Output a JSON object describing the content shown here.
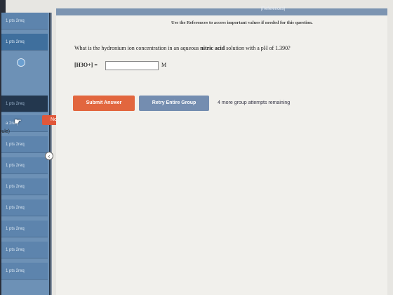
{
  "header": {
    "references_label": "[References]",
    "notice": "Use the References to access important values if needed for this question."
  },
  "question": {
    "text_before": "What is the hydronium ion concentration in an aqueous ",
    "bold_term": "nitric acid",
    "text_after": " solution with a pH of 1.390?",
    "input_label": "[H3O+] =",
    "answer_value": "",
    "unit": "M"
  },
  "actions": {
    "submit_label": "Submit Answer",
    "retry_label": "Retry Entire Group",
    "attempts_text": "4 more group attempts remaining"
  },
  "sidebar": {
    "items": [
      {
        "label": "1 pts   2req"
      },
      {
        "label": "1 pts   2req"
      },
      {
        "label": "1 pts   2req"
      },
      {
        "label": "a   2req"
      },
      {
        "label": "1 pts   2req"
      },
      {
        "label": "1 pts   2req"
      },
      {
        "label": "1 pts   2req"
      },
      {
        "label": "1 pts   2req"
      },
      {
        "label": "1 pts   2req"
      },
      {
        "label": "1 pts   2req"
      },
      {
        "label": "1 pts   2req"
      }
    ],
    "tooltip": "Not started",
    "rule_text": "rule)"
  },
  "colors": {
    "sidebar": "#6d91b6",
    "submit": "#e2663e",
    "retry": "#748db0"
  }
}
